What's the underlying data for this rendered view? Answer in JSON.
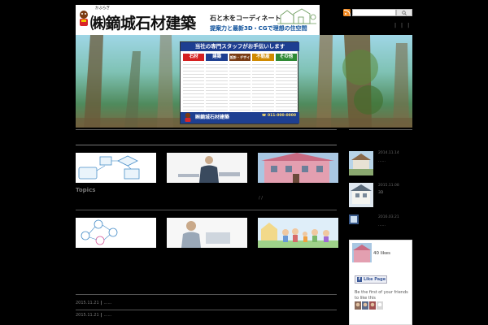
{
  "header": {
    "company_ruby": "かぶらぎ",
    "company_name": "㈱鏑城石材建築",
    "tagline_1": "石と木をコーディネート",
    "tagline_2": "提案力と最新3D・CGで理想の住空間",
    "search": {
      "placeholder": "",
      "button_icon": "search-icon"
    },
    "nav_items": [
      "|",
      "|",
      "|"
    ]
  },
  "hero": {
    "board_title": "当社の専門スタッフがお手伝いします",
    "columns": [
      {
        "label": "石材",
        "color": "#d52020"
      },
      {
        "label": "建築",
        "color": "#1e3f91"
      },
      {
        "label": "設計・デザイン",
        "color": "#7a3c14"
      },
      {
        "label": "不動産",
        "color": "#d08a00"
      },
      {
        "label": "その他",
        "color": "#2f8a35"
      }
    ],
    "footer_name": "㈱鏑城石材建築",
    "footer_phone": "☎ 011-000-0000"
  },
  "main": {
    "topics_label": "Topics",
    "center_mark": "/ /",
    "posts": [
      {
        "date": "2015.11.21",
        "sep": "|",
        "title": "……"
      },
      {
        "date": "2015.11.21",
        "sep": "|",
        "title": "……"
      }
    ]
  },
  "sidebar": {
    "recent_posts": [
      {
        "date": "2014.11.14",
        "title": "……"
      },
      {
        "date": "2015.11.08",
        "title": "3D"
      },
      {
        "date": "2016.03.21",
        "title": "……"
      }
    ],
    "facebook": {
      "likes_text": "40 likes",
      "like_button": "Like Page",
      "friends_text": "Be the first of your friends to like this"
    }
  }
}
